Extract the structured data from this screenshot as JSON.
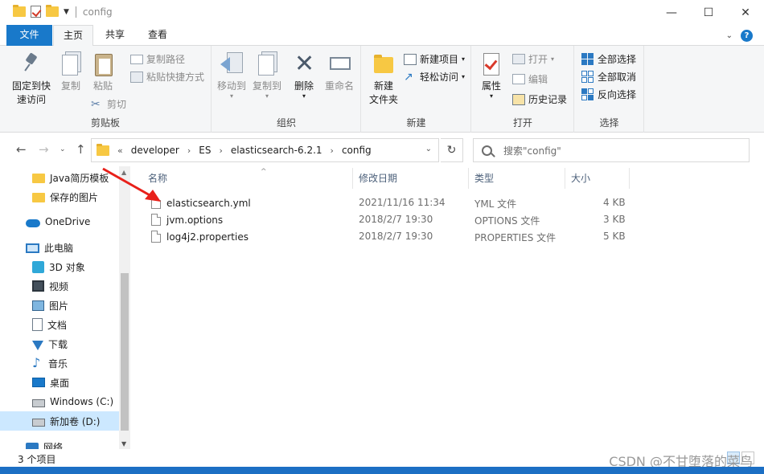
{
  "window": {
    "title": "config",
    "controls": {
      "minimize": "—",
      "maximize": "☐",
      "close": "✕"
    }
  },
  "ribbon_tabs": [
    {
      "label": "文件"
    },
    {
      "label": "主页"
    },
    {
      "label": "共享"
    },
    {
      "label": "查看"
    }
  ],
  "ribbon": {
    "clipboard": {
      "label": "剪贴板",
      "pin": "固定到快",
      "pin2": "速访问",
      "copy": "复制",
      "paste": "粘贴",
      "copy_path": "复制路径",
      "paste_shortcut": "粘贴快捷方式",
      "cut": "剪切"
    },
    "organize": {
      "label": "组织",
      "move_to": "移动到",
      "copy_to": "复制到",
      "delete": "删除",
      "rename": "重命名"
    },
    "new": {
      "label": "新建",
      "new_folder": "新建",
      "new_folder2": "文件夹",
      "new_item": "新建项目",
      "easy_access": "轻松访问"
    },
    "open": {
      "label": "打开",
      "properties": "属性",
      "open": "打开",
      "edit": "编辑",
      "history": "历史记录"
    },
    "select": {
      "label": "选择",
      "select_all": "全部选择",
      "select_none": "全部取消",
      "invert": "反向选择"
    }
  },
  "address": {
    "prefix": "«",
    "crumbs": [
      "developer",
      "ES",
      "elasticsearch-6.2.1",
      "config"
    ],
    "search_placeholder": "搜索\"config\""
  },
  "sidebar": {
    "items": [
      {
        "label": "Java简历模板",
        "icon": "folder-icon"
      },
      {
        "label": "保存的图片",
        "icon": "folder-icon"
      },
      {
        "label": "OneDrive",
        "icon": "cloud-icon"
      },
      {
        "label": "此电脑",
        "icon": "computer-icon"
      },
      {
        "label": "3D 对象",
        "icon": "cube-icon"
      },
      {
        "label": "视频",
        "icon": "video-icon"
      },
      {
        "label": "图片",
        "icon": "picture-icon"
      },
      {
        "label": "文档",
        "icon": "document-icon"
      },
      {
        "label": "下载",
        "icon": "download-icon"
      },
      {
        "label": "音乐",
        "icon": "music-icon"
      },
      {
        "label": "桌面",
        "icon": "desktop-icon"
      },
      {
        "label": "Windows (C:)",
        "icon": "drive-icon"
      },
      {
        "label": "新加卷 (D:)",
        "icon": "drive-icon"
      },
      {
        "label": "网络",
        "icon": "network-icon"
      }
    ]
  },
  "columns": {
    "name": "名称",
    "date": "修改日期",
    "type": "类型",
    "size": "大小"
  },
  "files": [
    {
      "name": "elasticsearch.yml",
      "date": "2021/11/16 11:34",
      "type": "YML 文件",
      "size": "4 KB"
    },
    {
      "name": "jvm.options",
      "date": "2018/2/7 19:30",
      "type": "OPTIONS 文件",
      "size": "3 KB"
    },
    {
      "name": "log4j2.properties",
      "date": "2018/2/7 19:30",
      "type": "PROPERTIES 文件",
      "size": "5 KB"
    }
  ],
  "status": {
    "item_count": "3 个项目"
  },
  "watermark": "CSDN @不甘堕落的菜鸟",
  "colors": {
    "accent": "#1979ca",
    "selection": "#cce8ff",
    "annotation": "#e8201a"
  }
}
